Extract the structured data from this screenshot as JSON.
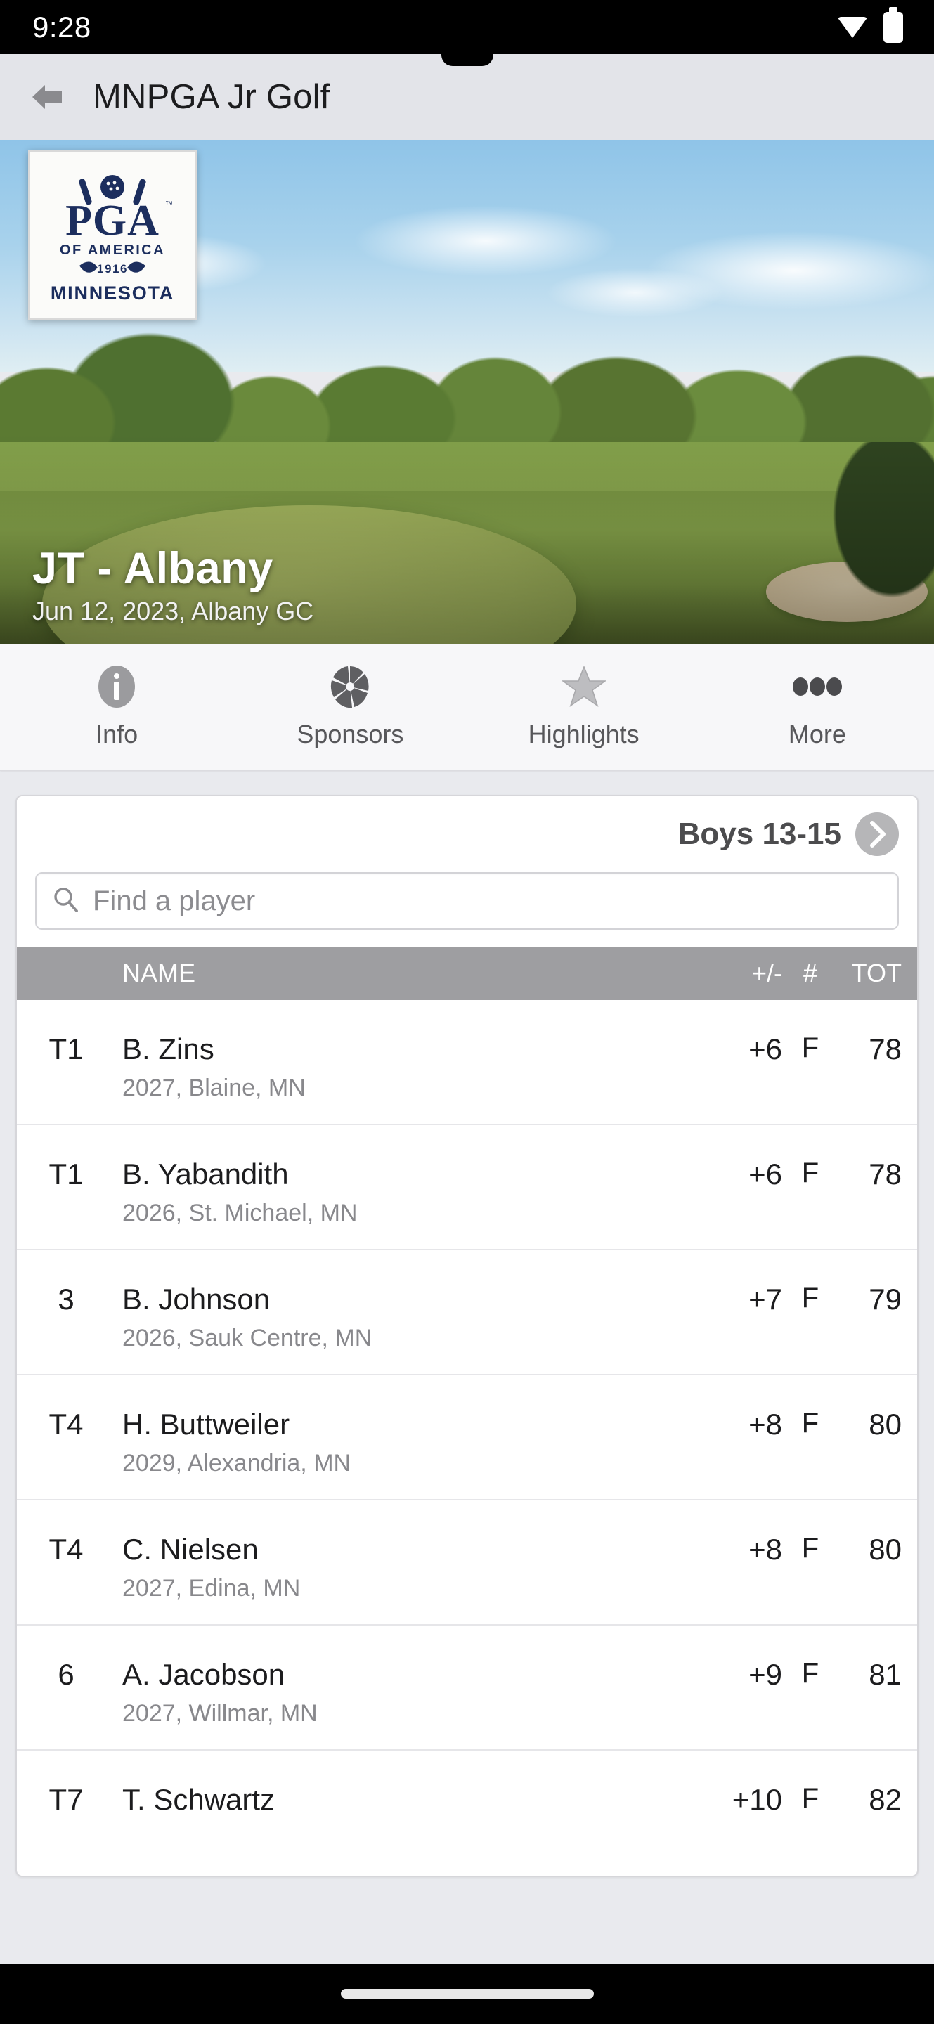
{
  "status_bar": {
    "time": "9:28",
    "wifi_icon": "wifi-icon",
    "battery_icon": "battery-icon"
  },
  "app_bar": {
    "back_icon": "back-arrow-icon",
    "title": "MNPGA Jr Golf"
  },
  "hero": {
    "logo_alt": "PGA of America Minnesota",
    "logo_line1": "PGA",
    "logo_line2": "OF AMERICA",
    "logo_year": "1916",
    "logo_line3": "MINNESOTA",
    "title": "JT - Albany",
    "subtitle": "Jun 12, 2023, Albany GC"
  },
  "tabs": [
    {
      "label": "Info",
      "icon": "info-icon"
    },
    {
      "label": "Sponsors",
      "icon": "aperture-icon"
    },
    {
      "label": "Highlights",
      "icon": "star-icon"
    },
    {
      "label": "More",
      "icon": "ellipsis-icon"
    }
  ],
  "division": {
    "name": "Boys 13-15",
    "next_icon": "chevron-right-icon"
  },
  "search": {
    "placeholder": "Find a player",
    "value": "",
    "icon": "search-icon"
  },
  "table": {
    "headers": {
      "rank": "",
      "name": "NAME",
      "plus_minus": "+/-",
      "hole": "#",
      "total": "TOT"
    },
    "rows": [
      {
        "rank": "T1",
        "name": "B. Zins",
        "meta": "2027, Blaine, MN",
        "plus_minus": "+6",
        "hole": "F",
        "total": "78"
      },
      {
        "rank": "T1",
        "name": "B. Yabandith",
        "meta": "2026, St. Michael, MN",
        "plus_minus": "+6",
        "hole": "F",
        "total": "78"
      },
      {
        "rank": "3",
        "name": "B. Johnson",
        "meta": "2026, Sauk Centre, MN",
        "plus_minus": "+7",
        "hole": "F",
        "total": "79"
      },
      {
        "rank": "T4",
        "name": "H. Buttweiler",
        "meta": "2029, Alexandria, MN",
        "plus_minus": "+8",
        "hole": "F",
        "total": "80"
      },
      {
        "rank": "T4",
        "name": "C. Nielsen",
        "meta": "2027, Edina, MN",
        "plus_minus": "+8",
        "hole": "F",
        "total": "80"
      },
      {
        "rank": "6",
        "name": "A. Jacobson",
        "meta": "2027, Willmar, MN",
        "plus_minus": "+9",
        "hole": "F",
        "total": "81"
      },
      {
        "rank": "T7",
        "name": "T. Schwartz",
        "meta": "",
        "plus_minus": "+10",
        "hole": "F",
        "total": "82"
      }
    ]
  },
  "colors": {
    "header_row": "#9e9ea1",
    "app_bar": "#e3e4e9",
    "logo_navy": "#1c2e5e",
    "divider": "#e6e6e9"
  }
}
